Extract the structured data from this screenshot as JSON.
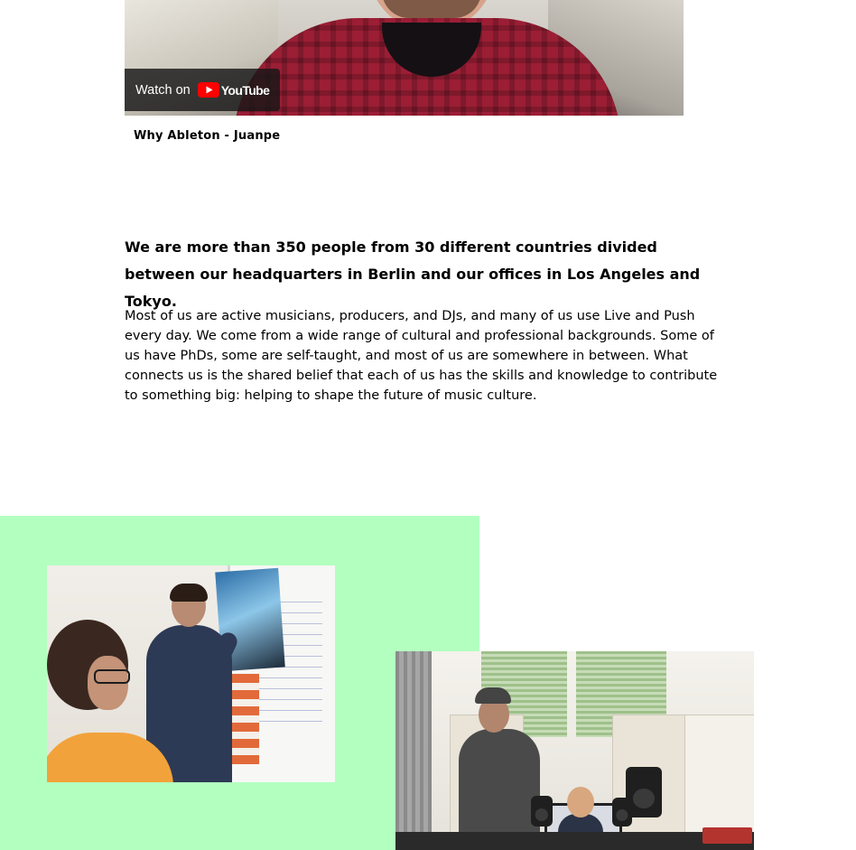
{
  "video": {
    "watch_on_label": "Watch on",
    "platform_name": "YouTube",
    "caption": "Why Ableton - Juanpe"
  },
  "intro": {
    "lead": "We are more than 350 people from 30 different countries divided between our headquarters in Berlin and our offices in Los Angeles and Tokyo.",
    "body": "Most of us are active musicians, producers, and DJs, and many of us use Live and Push every day. We come from a wide range of cultural and professional backgrounds. Some of us have PhDs, some are self-taught, and most of us are somewhere in between. What connects us is the shared belief that each of us has the skills and knowledge to contribute to something big: helping to shape the future of music culture."
  },
  "colors": {
    "green_block": "#b3ffc0",
    "youtube_red": "#ff0000",
    "text": "#000000"
  },
  "icons": {
    "youtube_logo": "youtube-play-icon"
  }
}
